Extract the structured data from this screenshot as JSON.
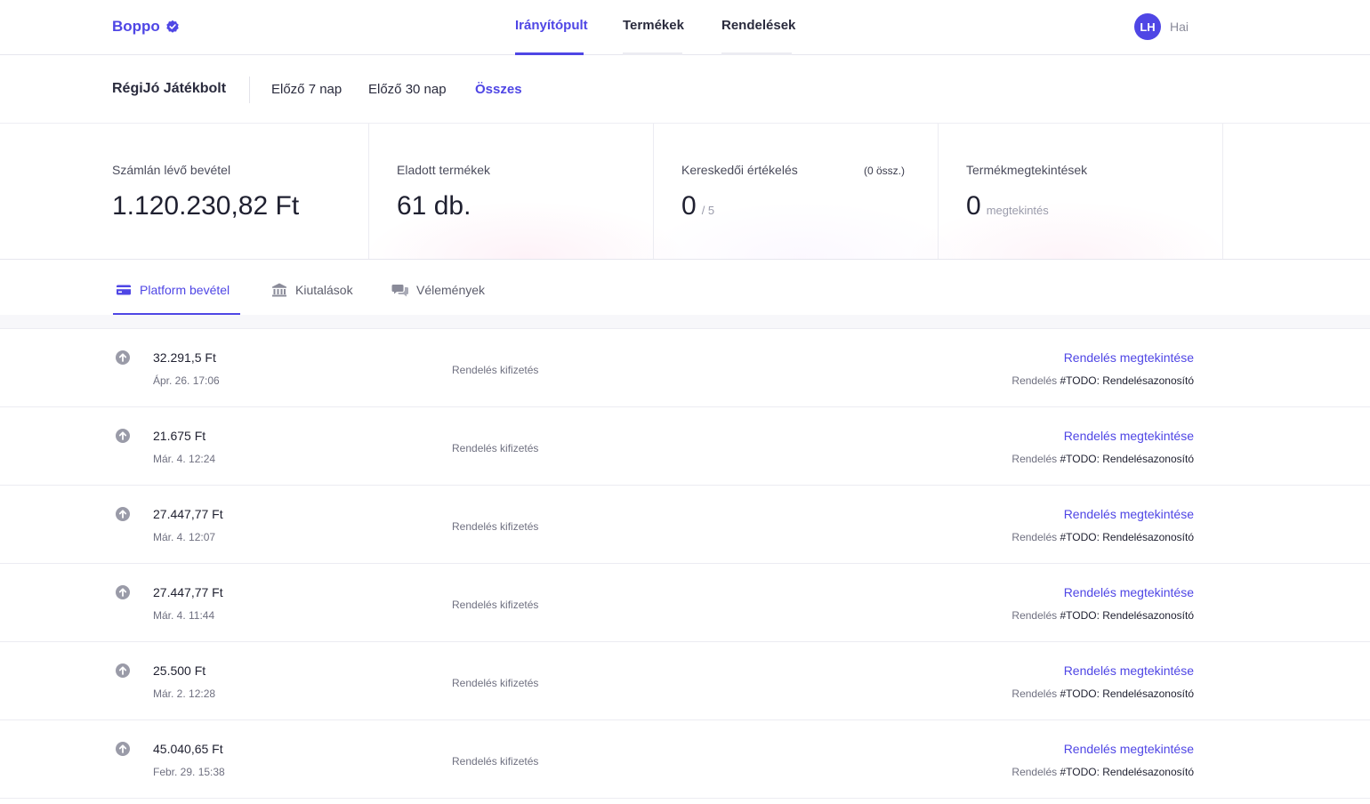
{
  "brand": {
    "name": "Boppo"
  },
  "nav": [
    {
      "label": "Irányítópult",
      "active": true
    },
    {
      "label": "Termékek",
      "active": false
    },
    {
      "label": "Rendelések",
      "active": false
    }
  ],
  "user": {
    "initials": "LH",
    "name": "Hai"
  },
  "store": {
    "name": "RégiJó Játékbolt"
  },
  "ranges": [
    {
      "label": "Előző 7 nap",
      "active": false
    },
    {
      "label": "Előző 30 nap",
      "active": false
    },
    {
      "label": "Összes",
      "active": true
    }
  ],
  "stats": {
    "revenue": {
      "label": "Számlán lévő bevétel",
      "value": "1.120.230,82 Ft"
    },
    "sold": {
      "label": "Eladott termékek",
      "value": "61 db."
    },
    "rating": {
      "label": "Kereskedői értékelés",
      "note": "(0 össz.)",
      "value": "0",
      "suffix": "/ 5"
    },
    "views": {
      "label": "Termékmegtekintések",
      "value": "0",
      "suffix": "megtekintés"
    }
  },
  "tabs": [
    {
      "label": "Platform bevétel",
      "icon": "credit-card-icon",
      "active": true
    },
    {
      "label": "Kiutalások",
      "icon": "bank-icon",
      "active": false
    },
    {
      "label": "Vélemények",
      "icon": "chat-bubbles-icon",
      "active": false
    }
  ],
  "colors": {
    "accent": "#4f46e5"
  },
  "transactions": [
    {
      "amount": "32.291,5 Ft",
      "date": "Ápr. 26. 17:06",
      "type": "Rendelés kifizetés",
      "link": "Rendelés megtekintése",
      "ref_prefix": "Rendelés",
      "ref_id": "#TODO: Rendelésazonosító"
    },
    {
      "amount": "21.675 Ft",
      "date": "Már. 4. 12:24",
      "type": "Rendelés kifizetés",
      "link": "Rendelés megtekintése",
      "ref_prefix": "Rendelés",
      "ref_id": "#TODO: Rendelésazonosító"
    },
    {
      "amount": "27.447,77 Ft",
      "date": "Már. 4. 12:07",
      "type": "Rendelés kifizetés",
      "link": "Rendelés megtekintése",
      "ref_prefix": "Rendelés",
      "ref_id": "#TODO: Rendelésazonosító"
    },
    {
      "amount": "27.447,77 Ft",
      "date": "Már. 4. 11:44",
      "type": "Rendelés kifizetés",
      "link": "Rendelés megtekintése",
      "ref_prefix": "Rendelés",
      "ref_id": "#TODO: Rendelésazonosító"
    },
    {
      "amount": "25.500 Ft",
      "date": "Már. 2. 12:28",
      "type": "Rendelés kifizetés",
      "link": "Rendelés megtekintése",
      "ref_prefix": "Rendelés",
      "ref_id": "#TODO: Rendelésazonosító"
    },
    {
      "amount": "45.040,65 Ft",
      "date": "Febr. 29. 15:38",
      "type": "Rendelés kifizetés",
      "link": "Rendelés megtekintése",
      "ref_prefix": "Rendelés",
      "ref_id": "#TODO: Rendelésazonosító"
    }
  ]
}
